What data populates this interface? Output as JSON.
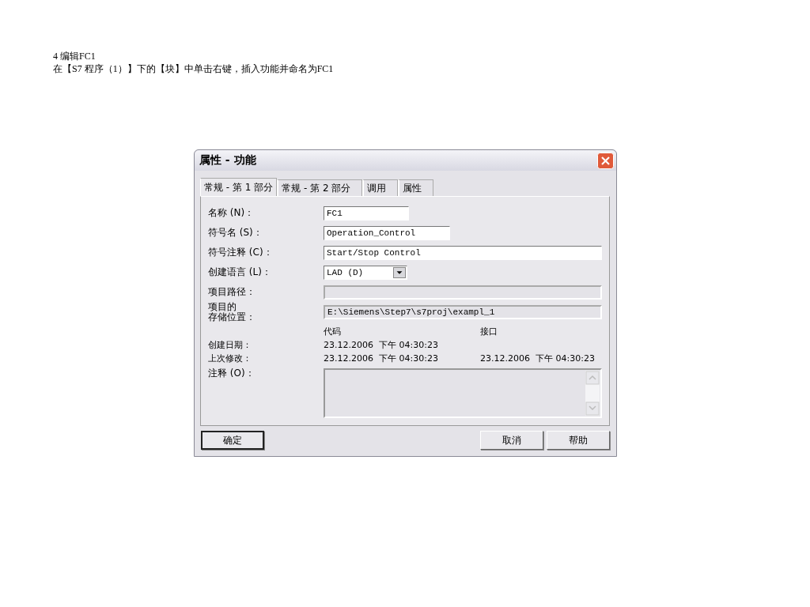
{
  "document": {
    "heading": "4 编辑FC1",
    "instruction": "在【S7 程序（1）】下的【块】中单击右键，插入功能并命名为FC1"
  },
  "dialog": {
    "title": "属性 - 功能",
    "tabs": [
      {
        "label": "常规 - 第 1 部分",
        "selected": true
      },
      {
        "label": "常规 - 第 2 部分",
        "selected": false
      },
      {
        "label": "调用",
        "selected": false
      },
      {
        "label": "属性",
        "selected": false
      }
    ],
    "fields": [
      {
        "kind": "text",
        "label": "名称 (N)：",
        "value": "FC1",
        "disabled": false
      },
      {
        "kind": "text",
        "label": "符号名 (S)：",
        "value": "Operation_Control",
        "disabled": false
      },
      {
        "kind": "text",
        "label": "符号注释 (C)：",
        "value": "Start/Stop Control",
        "disabled": false
      },
      {
        "kind": "dropdown",
        "label": "创建语言 (L)：",
        "value": "LAD (D)",
        "disabled": false
      },
      {
        "kind": "text",
        "label": "项目路径：",
        "disabled": true
      },
      {
        "kind": "text",
        "label_lines": [
          "项目的",
          "存储位置："
        ],
        "value": "E:\\Siemens\\Step7\\s7proj\\exampl_1",
        "disabled": true
      }
    ],
    "date_columns": [
      "代码",
      "接口"
    ],
    "dates": [
      {
        "label": "创建日期：",
        "code": "23.12.2006  下午 04:30:23"
      },
      {
        "label": "上次修改：",
        "code": "23.12.2006  下午 04:30:23",
        "interface": "23.12.2006  下午 04:30:23"
      }
    ],
    "comment": {
      "label": "注释 (O)：",
      "disabled": true
    },
    "buttons": [
      {
        "label": "确定",
        "default": true
      },
      {
        "label": "取消",
        "default": false
      },
      {
        "label": "帮助",
        "default": false
      }
    ]
  }
}
